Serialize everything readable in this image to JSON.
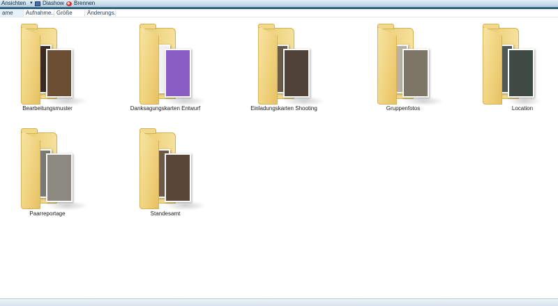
{
  "toolbar": {
    "views_label": "Ansichten",
    "slideshow_label": "Diashow",
    "burn_label": "Brennen"
  },
  "columns": [
    "ame",
    "Aufnahme...",
    "Größe",
    "Änderungs..."
  ],
  "folders": [
    {
      "name": "Bearbeitungsmuster",
      "thumb_a": "#3a2a1f",
      "thumb_b": "#6b4e34"
    },
    {
      "name": "Danksagungskarten Entwurf",
      "thumb_a": "#f2f2f2",
      "thumb_b": "#8a5ec2"
    },
    {
      "name": "Einladungskarten Shooting",
      "thumb_a": "#6a5a4a",
      "thumb_b": "#4f4339"
    },
    {
      "name": "Gruppenfotos",
      "thumb_a": "#b8b2a4",
      "thumb_b": "#7d7566"
    },
    {
      "name": "Location",
      "thumb_a": "#4e5a56",
      "thumb_b": "#3f4a45"
    },
    {
      "name": "Paarreportage",
      "thumb_a": "#7a7a72",
      "thumb_b": "#8c8a80"
    },
    {
      "name": "Standesamt",
      "thumb_a": "#6d5846",
      "thumb_b": "#5a4638"
    }
  ]
}
